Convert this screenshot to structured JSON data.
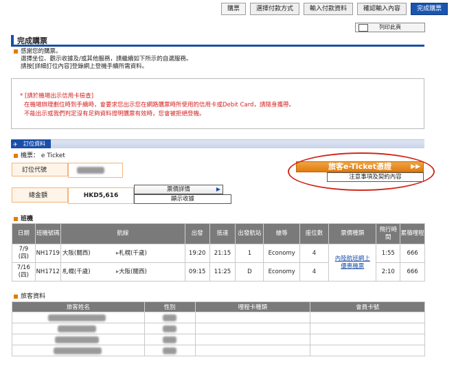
{
  "steps": [
    "購票",
    "選擇付款方式",
    "輸入付款資料",
    "確認輸入內容",
    "完成購票"
  ],
  "print_label": "列印此頁",
  "page_title": "完成購票",
  "messages": {
    "line1": "感謝您的購票。",
    "line2": "選擇坐位、觀示收據及/或其他服務，請繼續如下所示的自選服務。",
    "line3": "請按[詳細訂位內容]登錄網上登機手續所需資料。"
  },
  "warning": {
    "line1": "* [請於機場出示信用卡檢查]",
    "line2": "在機場辦理劃位時到手續時，會要求您出示您在網路購票時所使用的信用卡或Debit Card，請隨身攜帶。",
    "line3": "不能出示或我們判定沒有足夠資料證明購票有效時，您會被拒絕登機。"
  },
  "booking": {
    "section_label": "訂位資料",
    "ticket_type": "機票： e Ticket",
    "ref_label": "訂位代號",
    "total_label": "總金額",
    "total_value": "HKD5,616",
    "fare_detail_btn": "票價詳情",
    "receipt_btn": "顯示收據",
    "eticket_btn": "旅客e-Ticket憑證",
    "notice_btn": "注意事項及契約內容"
  },
  "flights": {
    "heading": "班機",
    "headers": [
      "日期",
      "班機號碼",
      "航線",
      "出發",
      "抵達",
      "出發航站",
      "艙等",
      "座位數",
      "票價種類",
      "飛行時間",
      "累積哩程"
    ],
    "rows": [
      {
        "date": "7/9\n(四)",
        "flight": "NH1719",
        "from": "大阪(關西)",
        "to": "札幌(千歲)",
        "dep": "19:20",
        "arr": "21:15",
        "terminal": "1",
        "cabin": "Economy",
        "seats": "4",
        "duration": "1:55",
        "miles": "666"
      },
      {
        "date": "7/16\n(四)",
        "flight": "NH1712",
        "from": "札幌(千歲)",
        "to": "大阪(關西)",
        "dep": "09:15",
        "arr": "11:25",
        "terminal": "D",
        "cabin": "Economy",
        "seats": "4",
        "duration": "2:10",
        "miles": "666"
      }
    ],
    "fare_type": "內陸航班網上優惠機票"
  },
  "passengers": {
    "heading": "旅客資料",
    "headers": [
      "旅客姓名",
      "性別",
      "哩程卡種類",
      "會員卡號"
    ],
    "row_count": 4
  },
  "colors": {
    "accent": "#1a4ea8",
    "eticket": "#e07b10",
    "warning": "#d42020"
  }
}
